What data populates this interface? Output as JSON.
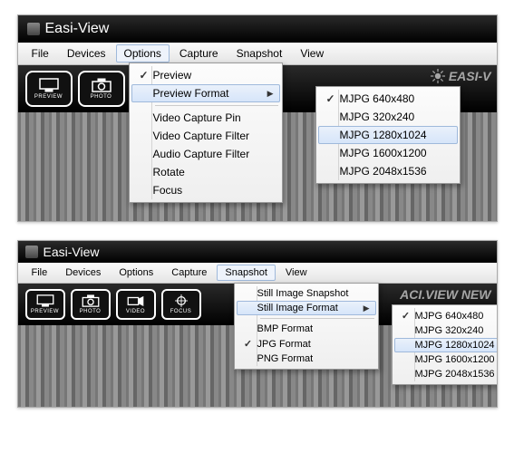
{
  "app_title": "Easi-View",
  "menubar": [
    "File",
    "Devices",
    "Options",
    "Capture",
    "Snapshot",
    "View"
  ],
  "toolbar": {
    "preview": "PREVIEW",
    "photo": "PHOTO",
    "video": "VIDEO",
    "focus": "FOCUS"
  },
  "brand_partial_top": "EASI-V",
  "brand_partial_bottom": "ACI.VIEW NEW",
  "win1": {
    "open_menu_index": 2,
    "drop": {
      "preview": "Preview",
      "preview_checked": true,
      "preview_format": "Preview Format",
      "video_capture_pin": "Video Capture Pin",
      "video_capture_filter": "Video Capture Filter",
      "audio_capture_filter": "Audio Capture Filter",
      "rotate": "Rotate",
      "focus": "Focus"
    },
    "sub": {
      "items": [
        {
          "label": "MJPG 640x480",
          "checked": true,
          "hover": false
        },
        {
          "label": "MJPG 320x240",
          "checked": false,
          "hover": false
        },
        {
          "label": "MJPG 1280x1024",
          "checked": false,
          "hover": true
        },
        {
          "label": "MJPG 1600x1200",
          "checked": false,
          "hover": false
        },
        {
          "label": "MJPG 2048x1536",
          "checked": false,
          "hover": false
        }
      ]
    }
  },
  "win2": {
    "open_menu_index": 4,
    "drop": {
      "still_image_snapshot": "Still Image Snapshot",
      "still_image_format": "Still Image Format",
      "bmp": "BMP Format",
      "jpg": "JPG Format",
      "jpg_checked": true,
      "png": "PNG Format"
    },
    "sub": {
      "items": [
        {
          "label": "MJPG 640x480",
          "checked": true,
          "hover": false
        },
        {
          "label": "MJPG 320x240",
          "checked": false,
          "hover": false
        },
        {
          "label": "MJPG 1280x1024",
          "checked": false,
          "hover": true
        },
        {
          "label": "MJPG 1600x1200",
          "checked": false,
          "hover": false
        },
        {
          "label": "MJPG 2048x1536",
          "checked": false,
          "hover": false
        }
      ]
    }
  }
}
